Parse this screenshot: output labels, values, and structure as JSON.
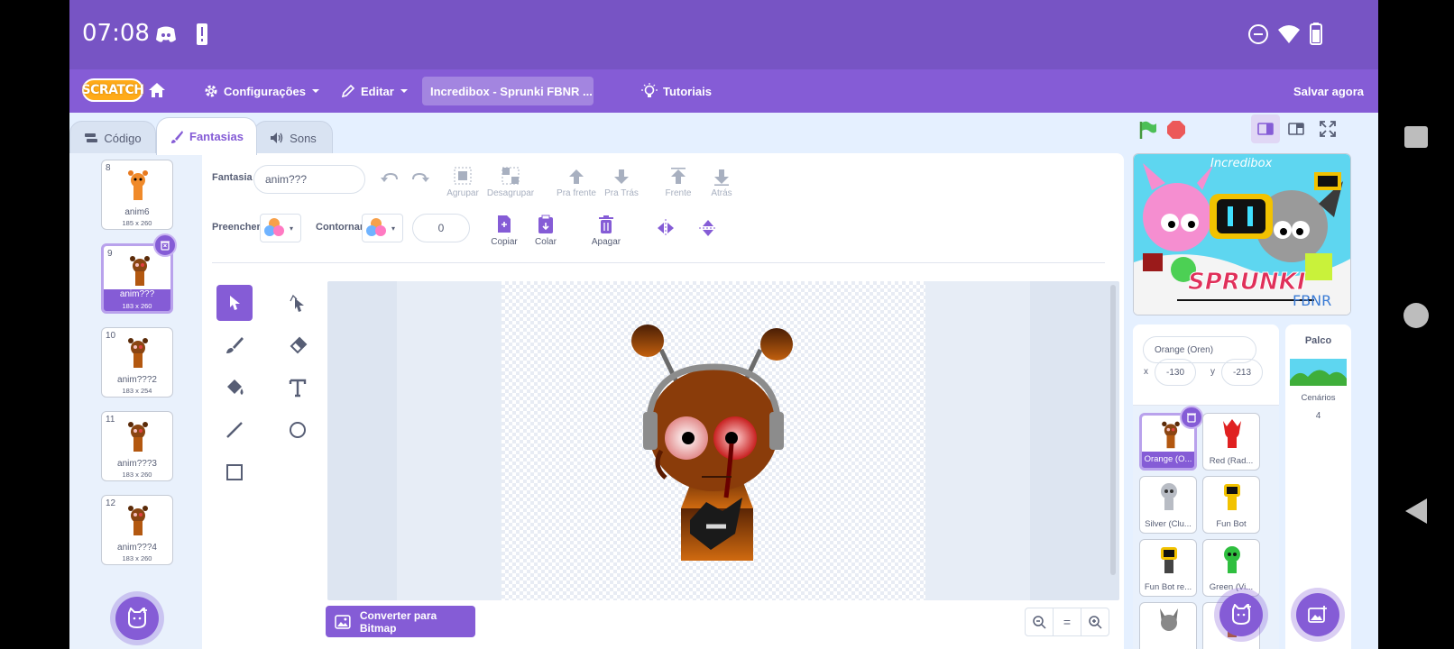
{
  "status_bar": {
    "time": "07:08"
  },
  "menu": {
    "logo": "SCRATCH",
    "settings": "Configurações",
    "edit": "Editar",
    "project_title": "Incredibox - Sprunki FBNR  ...",
    "tutorials": "Tutoriais",
    "save_now": "Salvar agora"
  },
  "tabs": {
    "code": "Código",
    "costumes": "Fantasias",
    "sounds": "Sons"
  },
  "costumes": [
    {
      "num": "8",
      "name": "anim6",
      "size": "185 x 260"
    },
    {
      "num": "9",
      "name": "anim???",
      "size": "183 x 260"
    },
    {
      "num": "10",
      "name": "anim???2",
      "size": "183 x 254"
    },
    {
      "num": "11",
      "name": "anim???3",
      "size": "183 x 260"
    },
    {
      "num": "12",
      "name": "anim???4",
      "size": "183 x 260"
    }
  ],
  "editor": {
    "costume_label": "Fantasia",
    "costume_name": "anim???",
    "fill_label": "Preencher",
    "outline_label": "Contornar",
    "outline_width": "0",
    "group": "Agrupar",
    "ungroup": "Desagrupar",
    "forward": "Pra frente",
    "backward": "Pra Trás",
    "front": "Frente",
    "back": "Atrás",
    "copy": "Copiar",
    "paste": "Colar",
    "delete": "Apagar",
    "convert_bitmap": "Converter para Bitmap",
    "zoom_reset": "="
  },
  "stage_preview": {
    "top_text": "Incredibox",
    "logo_text": "SPRUNKI",
    "tag": "FBNR"
  },
  "sprite_info": {
    "name": "Orange (Oren)",
    "x_label": "x",
    "x": "-130",
    "y_label": "y",
    "y": "-213"
  },
  "sprites": [
    {
      "name": "Orange (O...",
      "color": "#c85a10"
    },
    {
      "name": "Red (Rad...",
      "color": "#e02020"
    },
    {
      "name": "Silver (Clu...",
      "color": "#b8bcc4"
    },
    {
      "name": "Fun Bot",
      "color": "#f2c200"
    },
    {
      "name": "Fun Bot re...",
      "color": "#f2c200"
    },
    {
      "name": "Green (Vi...",
      "color": "#2fbf3f"
    }
  ],
  "stage_pane": {
    "title": "Palco",
    "backdrops_label": "Cenários",
    "backdrops_count": "4"
  },
  "colors": {
    "accent": "#855cd6",
    "status_bar": "#7754c4",
    "text": "#575e75"
  }
}
